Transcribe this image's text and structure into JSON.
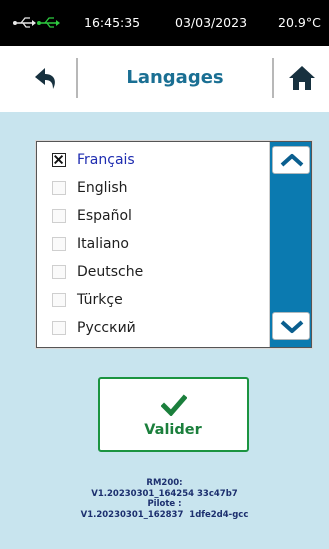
{
  "status_bar": {
    "usb_icon": "usb-connected-icon",
    "time": "16:45:35",
    "date": "03/03/2023",
    "temperature": "20.9°C"
  },
  "header": {
    "title": "Langages",
    "back_icon": "back-arrow-icon",
    "home_icon": "home-icon"
  },
  "languages": {
    "items": [
      {
        "label": "Français",
        "checked": true
      },
      {
        "label": "English",
        "checked": false
      },
      {
        "label": "Español",
        "checked": false
      },
      {
        "label": "Italiano",
        "checked": false
      },
      {
        "label": "Deutsche",
        "checked": false
      },
      {
        "label": "Türkçe",
        "checked": false
      },
      {
        "label": "Русский",
        "checked": false
      }
    ]
  },
  "validate": {
    "label": "Valider",
    "icon": "checkmark-icon"
  },
  "version": {
    "line1": "RM200:",
    "line2": "V1.20230301_164254 33c47b7",
    "line3": "Pilote :",
    "line4": "V1.20230301_162837  1dfe2d4-gcc"
  },
  "colors": {
    "accent_blue": "#1a6f93",
    "scroll_blue": "#0b7ab0",
    "background": "#c8e4ee",
    "confirm_green": "#1b9440",
    "usb_green": "#2ecc40"
  }
}
